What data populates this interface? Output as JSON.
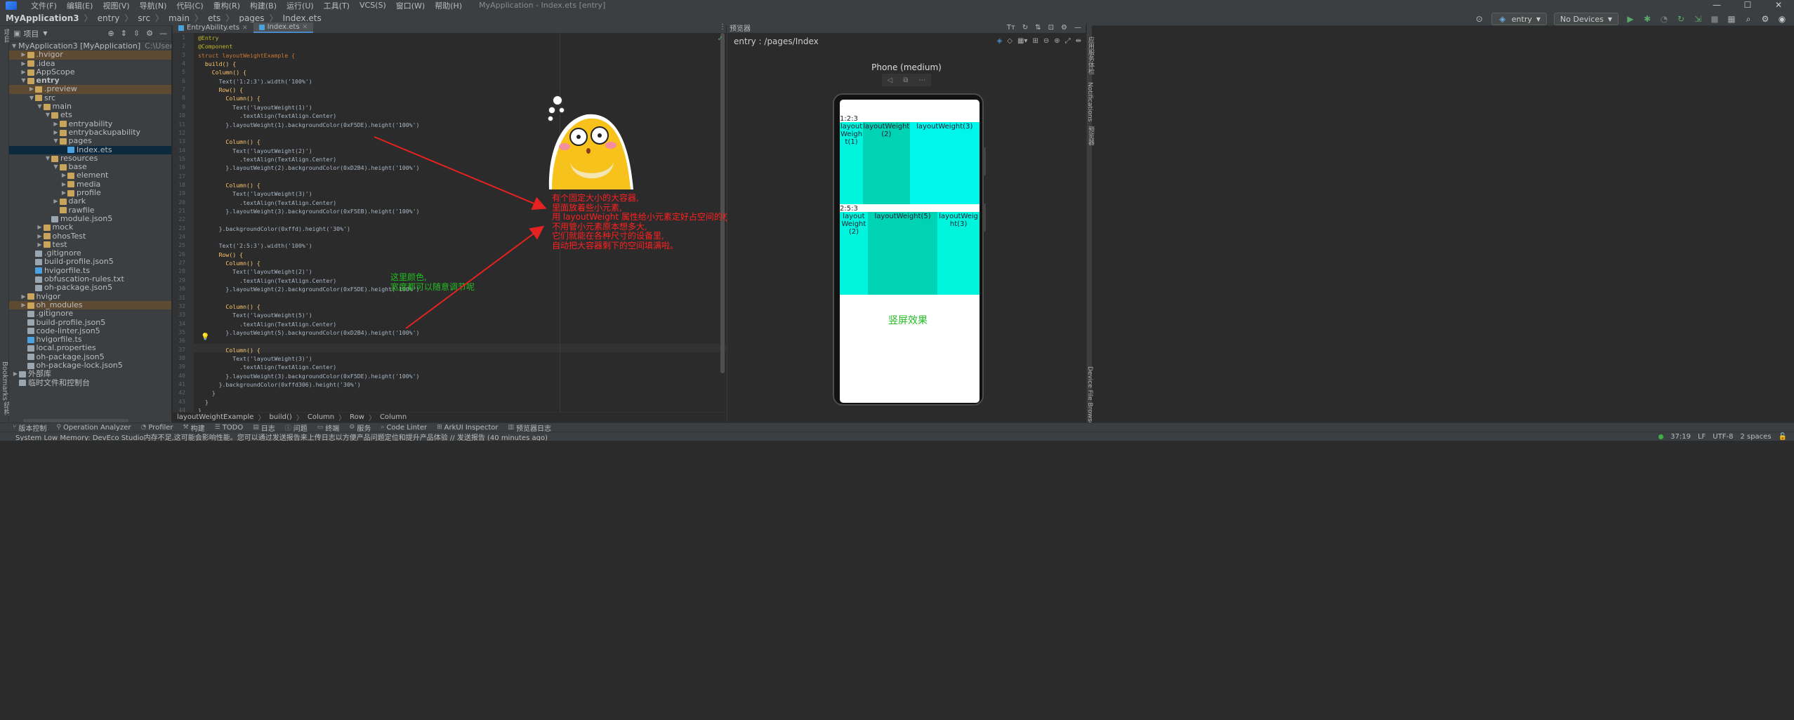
{
  "menu": {
    "items": [
      "文件(F)",
      "编辑(E)",
      "视图(V)",
      "导航(N)",
      "代码(C)",
      "重构(R)",
      "构建(B)",
      "运行(U)",
      "工具(T)",
      "VCS(S)",
      "窗口(W)",
      "帮助(H)"
    ],
    "window_title": "MyApplication - Index.ets [entry]"
  },
  "breadcrumb": [
    "MyApplication3",
    "entry",
    "src",
    "main",
    "ets",
    "pages",
    "Index.ets"
  ],
  "toolbar": {
    "module": "entry",
    "device": "No Devices"
  },
  "project_panel": {
    "title": "项目",
    "tree": [
      {
        "depth": 0,
        "arrow": "v",
        "icon": "fold",
        "label": "MyApplication3 [MyApplication]",
        "path": "C:\\Users\\MSN\\DevEco",
        "hl": ""
      },
      {
        "depth": 1,
        "arrow": ">",
        "icon": "fold",
        "label": ".hvigor",
        "hl": "mod"
      },
      {
        "depth": 1,
        "arrow": ">",
        "icon": "fold",
        "label": ".idea",
        "hl": ""
      },
      {
        "depth": 1,
        "arrow": ">",
        "icon": "fold",
        "label": "AppScope",
        "hl": ""
      },
      {
        "depth": 1,
        "arrow": "v",
        "icon": "fold",
        "label": "entry",
        "hl": "",
        "bold": true
      },
      {
        "depth": 2,
        "arrow": ">",
        "icon": "fold",
        "label": ".preview",
        "hl": "mod"
      },
      {
        "depth": 2,
        "arrow": "v",
        "icon": "fold",
        "label": "src",
        "hl": ""
      },
      {
        "depth": 3,
        "arrow": "v",
        "icon": "fold",
        "label": "main",
        "hl": ""
      },
      {
        "depth": 4,
        "arrow": "v",
        "icon": "fold",
        "label": "ets",
        "hl": ""
      },
      {
        "depth": 5,
        "arrow": ">",
        "icon": "fold",
        "label": "entryability",
        "hl": ""
      },
      {
        "depth": 5,
        "arrow": ">",
        "icon": "fold",
        "label": "entrybackupability",
        "hl": ""
      },
      {
        "depth": 5,
        "arrow": "v",
        "icon": "fold",
        "label": "pages",
        "hl": ""
      },
      {
        "depth": 6,
        "arrow": "",
        "icon": "ts",
        "label": "Index.ets",
        "hl": "sel"
      },
      {
        "depth": 4,
        "arrow": "v",
        "icon": "fold",
        "label": "resources",
        "hl": ""
      },
      {
        "depth": 5,
        "arrow": "v",
        "icon": "fold",
        "label": "base",
        "hl": ""
      },
      {
        "depth": 6,
        "arrow": ">",
        "icon": "fold",
        "label": "element",
        "hl": ""
      },
      {
        "depth": 6,
        "arrow": ">",
        "icon": "fold",
        "label": "media",
        "hl": ""
      },
      {
        "depth": 6,
        "arrow": ">",
        "icon": "fold",
        "label": "profile",
        "hl": ""
      },
      {
        "depth": 5,
        "arrow": ">",
        "icon": "fold",
        "label": "dark",
        "hl": ""
      },
      {
        "depth": 5,
        "arrow": "",
        "icon": "fold",
        "label": "rawfile",
        "hl": ""
      },
      {
        "depth": 4,
        "arrow": "",
        "icon": "file",
        "label": "module.json5",
        "hl": ""
      },
      {
        "depth": 3,
        "arrow": ">",
        "icon": "fold",
        "label": "mock",
        "hl": ""
      },
      {
        "depth": 3,
        "arrow": ">",
        "icon": "fold",
        "label": "ohosTest",
        "hl": ""
      },
      {
        "depth": 3,
        "arrow": ">",
        "icon": "fold",
        "label": "test",
        "hl": ""
      },
      {
        "depth": 2,
        "arrow": "",
        "icon": "file",
        "label": ".gitignore",
        "hl": ""
      },
      {
        "depth": 2,
        "arrow": "",
        "icon": "file",
        "label": "build-profile.json5",
        "hl": ""
      },
      {
        "depth": 2,
        "arrow": "",
        "icon": "ts",
        "label": "hvigorfile.ts",
        "hl": ""
      },
      {
        "depth": 2,
        "arrow": "",
        "icon": "file",
        "label": "obfuscation-rules.txt",
        "hl": ""
      },
      {
        "depth": 2,
        "arrow": "",
        "icon": "file",
        "label": "oh-package.json5",
        "hl": ""
      },
      {
        "depth": 1,
        "arrow": ">",
        "icon": "fold",
        "label": "hvigor",
        "hl": ""
      },
      {
        "depth": 1,
        "arrow": ">",
        "icon": "fold",
        "label": "oh_modules",
        "hl": "mod"
      },
      {
        "depth": 1,
        "arrow": "",
        "icon": "file",
        "label": ".gitignore",
        "hl": ""
      },
      {
        "depth": 1,
        "arrow": "",
        "icon": "file",
        "label": "build-profile.json5",
        "hl": ""
      },
      {
        "depth": 1,
        "arrow": "",
        "icon": "file",
        "label": "code-linter.json5",
        "hl": ""
      },
      {
        "depth": 1,
        "arrow": "",
        "icon": "ts",
        "label": "hvigorfile.ts",
        "hl": ""
      },
      {
        "depth": 1,
        "arrow": "",
        "icon": "file",
        "label": "local.properties",
        "hl": ""
      },
      {
        "depth": 1,
        "arrow": "",
        "icon": "file",
        "label": "oh-package.json5",
        "hl": ""
      },
      {
        "depth": 1,
        "arrow": "",
        "icon": "file",
        "label": "oh-package-lock.json5",
        "hl": ""
      },
      {
        "depth": 0,
        "arrow": ">",
        "icon": "file",
        "label": "外部库",
        "hl": ""
      },
      {
        "depth": 0,
        "arrow": "",
        "icon": "file",
        "label": "临时文件和控制台",
        "hl": ""
      }
    ]
  },
  "editor": {
    "tabs": [
      {
        "label": "EntryAbility.ets",
        "active": false
      },
      {
        "label": "Index.ets",
        "active": true
      }
    ],
    "lines": [
      {
        "n": "1",
        "t": "@Entry",
        "c": "#bbb529"
      },
      {
        "n": "2",
        "t": "@Component",
        "c": "#bbb529"
      },
      {
        "n": "3",
        "t": "struct layoutWeightExample {",
        "c": "#cc7832"
      },
      {
        "n": "4",
        "t": "  build() {",
        "c": "#ffc66d"
      },
      {
        "n": "5",
        "t": "    Column() {",
        "c": "#ffc66d"
      },
      {
        "n": "6",
        "t": "      Text('1:2:3').width('100%')",
        "c": "#a9b7c6"
      },
      {
        "n": "7",
        "t": "      Row() {",
        "c": "#ffc66d"
      },
      {
        "n": "8",
        "t": "        Column() {",
        "c": "#ffc66d"
      },
      {
        "n": "9",
        "t": "          Text('layoutWeight(1)')",
        "c": "#a9b7c6"
      },
      {
        "n": "10",
        "t": "            .textAlign(TextAlign.Center)",
        "c": "#a9b7c6"
      },
      {
        "n": "11",
        "t": "        }.layoutWeight(1).backgroundColor(0xF5DE).height('100%')",
        "c": "#a9b7c6"
      },
      {
        "n": "12",
        "t": "",
        "c": "#a9b7c6"
      },
      {
        "n": "13",
        "t": "        Column() {",
        "c": "#ffc66d"
      },
      {
        "n": "14",
        "t": "          Text('layoutWeight(2)')",
        "c": "#a9b7c6"
      },
      {
        "n": "15",
        "t": "            .textAlign(TextAlign.Center)",
        "c": "#a9b7c6"
      },
      {
        "n": "16",
        "t": "        }.layoutWeight(2).backgroundColor(0xD2B4).height('100%')",
        "c": "#a9b7c6"
      },
      {
        "n": "17",
        "t": "",
        "c": "#a9b7c6"
      },
      {
        "n": "18",
        "t": "        Column() {",
        "c": "#ffc66d"
      },
      {
        "n": "19",
        "t": "          Text('layoutWeight(3)')",
        "c": "#a9b7c6"
      },
      {
        "n": "20",
        "t": "            .textAlign(TextAlign.Center)",
        "c": "#a9b7c6"
      },
      {
        "n": "21",
        "t": "        }.layoutWeight(3).backgroundColor(0xF5EB).height('100%')",
        "c": "#a9b7c6"
      },
      {
        "n": "22",
        "t": "",
        "c": "#a9b7c6"
      },
      {
        "n": "23",
        "t": "      }.backgroundColor(0xffd).height('30%')",
        "c": "#a9b7c6"
      },
      {
        "n": "24",
        "t": "",
        "c": "#a9b7c6"
      },
      {
        "n": "25",
        "t": "      Text('2:5:3').width('100%')",
        "c": "#a9b7c6"
      },
      {
        "n": "26",
        "t": "      Row() {",
        "c": "#ffc66d"
      },
      {
        "n": "27",
        "t": "        Column() {",
        "c": "#ffc66d"
      },
      {
        "n": "28",
        "t": "          Text('layoutWeight(2)')",
        "c": "#a9b7c6"
      },
      {
        "n": "29",
        "t": "            .textAlign(TextAlign.Center)",
        "c": "#a9b7c6"
      },
      {
        "n": "30",
        "t": "        }.layoutWeight(2).backgroundColor(0xF5DE).height('100%')",
        "c": "#a9b7c6"
      },
      {
        "n": "31",
        "t": "",
        "c": "#a9b7c6"
      },
      {
        "n": "32",
        "t": "        Column() {",
        "c": "#ffc66d"
      },
      {
        "n": "33",
        "t": "          Text('layoutWeight(5)')",
        "c": "#a9b7c6"
      },
      {
        "n": "34",
        "t": "            .textAlign(TextAlign.Center)",
        "c": "#a9b7c6"
      },
      {
        "n": "35",
        "t": "        }.layoutWeight(5).backgroundColor(0xD2B4).height('100%')",
        "c": "#a9b7c6"
      },
      {
        "n": "36",
        "t": "",
        "c": "#a9b7c6"
      },
      {
        "n": "37",
        "t": "        Column() {",
        "c": "#ffc66d"
      },
      {
        "n": "38",
        "t": "          Text('layoutWeight(3)')",
        "c": "#a9b7c6"
      },
      {
        "n": "39",
        "t": "            .textAlign(TextAlign.Center)",
        "c": "#a9b7c6"
      },
      {
        "n": "40",
        "t": "        }.layoutWeight(3).backgroundColor(0xF5DE).height('100%')",
        "c": "#a9b7c6"
      },
      {
        "n": "41",
        "t": "      }.backgroundColor(0xffd306).height('30%')",
        "c": "#a9b7c6"
      },
      {
        "n": "42",
        "t": "    }",
        "c": "#a9b7c6"
      },
      {
        "n": "43",
        "t": "  }",
        "c": "#a9b7c6"
      },
      {
        "n": "44",
        "t": "}",
        "c": "#a9b7c6"
      }
    ],
    "breadcrumb": [
      "layoutWeightExample",
      "build()",
      "Column",
      "Row",
      "Column"
    ]
  },
  "annotations": {
    "red_note": "有个固定大小的大容器,\n里面放着些小元素,\n用 layoutWeight 属性给小元素定好占空间的权重,\n不用管小元素原本想多大,\n它们就能在各种尺寸的设备里,\n自动把大容器剩下的空间填满啦。",
    "green_note": "这里颜色,\n宽度都可以随意调节呢",
    "green_caption": "竖屏效果"
  },
  "preview": {
    "panel_title": "预览器",
    "route": "entry : /pages/Index",
    "device_name": "Phone (medium)",
    "row1": {
      "label": "1:2:3",
      "cells": [
        {
          "text": "layoutWeight(1)",
          "weight": 1,
          "color": "#00f5de"
        },
        {
          "text": "layoutWeight(2)",
          "weight": 2,
          "color": "#00d2b4"
        },
        {
          "text": "layoutWeight(3)",
          "weight": 3,
          "color": "#00f5eb"
        }
      ]
    },
    "row2": {
      "label": "2:5:3",
      "cells": [
        {
          "text": "layoutWeight(2)",
          "weight": 2,
          "color": "#00f5de"
        },
        {
          "text": "layoutWeight(5)",
          "weight": 5,
          "color": "#00d2b4"
        },
        {
          "text": "layoutWeight(3)",
          "weight": 3,
          "color": "#00f5de"
        }
      ]
    }
  },
  "right_strip": [
    "应用服务体检",
    "Notifications",
    "预览器",
    "Device File Browser"
  ],
  "left_strip": [
    "项目",
    "Bookmarks",
    "结构"
  ],
  "tool_tabs": [
    "版本控制",
    "Operation Analyzer",
    "Profiler",
    "构建",
    "TODO",
    "日志",
    "问题",
    "终端",
    "服务",
    "Code Linter",
    "ArkUI Inspector",
    "预览器日志"
  ],
  "status": {
    "message": "System Low Memory: DevEco Studio内存不足,这可能会影响性能。您可以通过发送报告来上传日志以方便产品问题定位和提升产品体验 // 发送报告 (40 minutes ago)",
    "position": "37:19",
    "line_sep": "LF",
    "encoding": "UTF-8",
    "indent": "2 spaces"
  }
}
